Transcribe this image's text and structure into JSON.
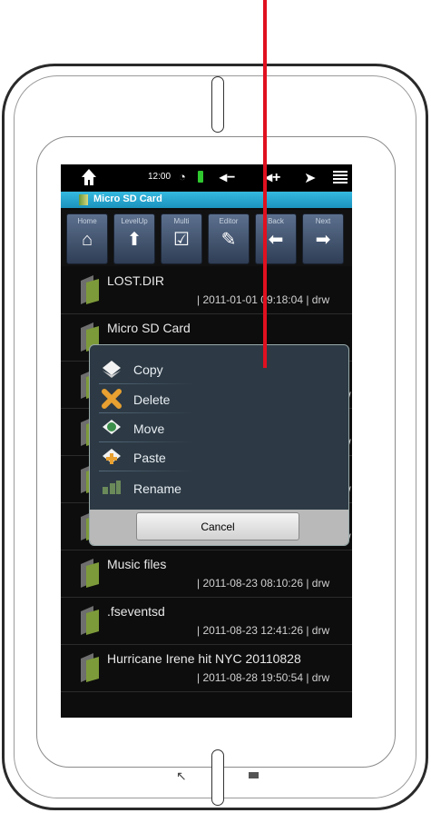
{
  "status": {
    "time": "12:00"
  },
  "titlebar": {
    "title": "Micro SD Card"
  },
  "toolbar": [
    {
      "label": "Home",
      "icon": "home-icon",
      "glyph": "⌂"
    },
    {
      "label": "LevelUp",
      "icon": "level-up-icon",
      "glyph": "⬆"
    },
    {
      "label": "Multi",
      "icon": "checkbox-icon",
      "glyph": "☑"
    },
    {
      "label": "Editor",
      "icon": "pencil-icon",
      "glyph": "✎"
    },
    {
      "label": "Back",
      "icon": "arrow-left-icon",
      "glyph": "⬅"
    },
    {
      "label": "Next",
      "icon": "arrow-right-icon",
      "glyph": "➡"
    }
  ],
  "files": [
    {
      "name": "LOST.DIR",
      "meta": "| 2011-01-01 09:18:04 | drw"
    },
    {
      "name": "Micro SD Card",
      "meta": ""
    },
    {
      "name": "",
      "meta": "w"
    },
    {
      "name": "",
      "meta": "w"
    },
    {
      "name": "",
      "meta": "w"
    },
    {
      "name": "",
      "meta": "w"
    },
    {
      "name": "Music files",
      "meta": "| 2011-08-23 08:10:26 | drw"
    },
    {
      "name": ".fseventsd",
      "meta": "| 2011-08-23 12:41:26 | drw"
    },
    {
      "name": "Hurricane Irene hit NYC 20110828",
      "meta": "| 2011-08-28 19:50:54 | drw"
    }
  ],
  "dialog": {
    "items": [
      {
        "label": "Copy",
        "icon": "copy-icon"
      },
      {
        "label": "Delete",
        "icon": "delete-icon"
      },
      {
        "label": "Move",
        "icon": "move-icon"
      },
      {
        "label": "Paste",
        "icon": "paste-icon"
      },
      {
        "label": "Rename",
        "icon": "rename-icon"
      }
    ],
    "cancel": "Cancel"
  },
  "colors": {
    "accent": "#1b92bd",
    "pointer": "#e01020",
    "battery": "#2fc82f"
  }
}
